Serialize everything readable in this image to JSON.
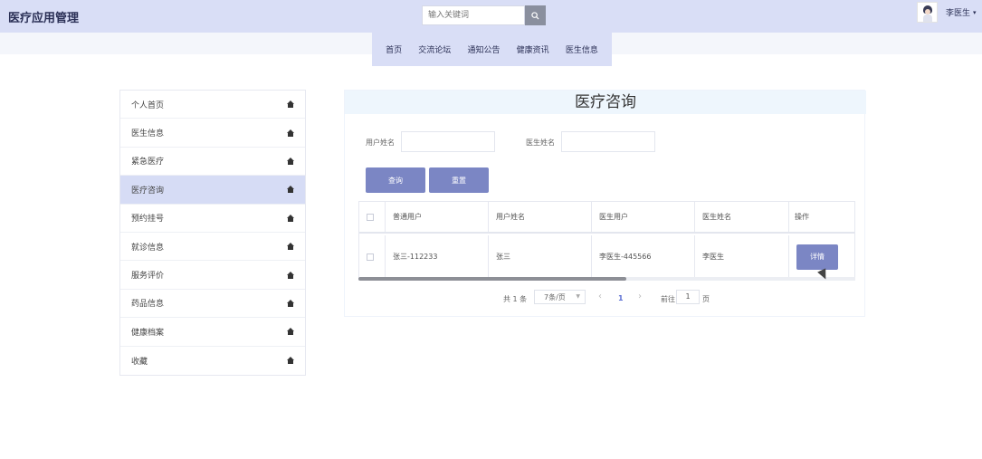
{
  "header": {
    "title": "医疗应用管理",
    "search_placeholder": "输入关键词",
    "search_icon": "search-icon",
    "user_name": "李医生",
    "caret": "▾"
  },
  "nav": {
    "items": [
      "首页",
      "交流论坛",
      "通知公告",
      "健康资讯",
      "医生信息"
    ]
  },
  "sidebar": {
    "items": [
      {
        "label": "个人首页"
      },
      {
        "label": "医生信息"
      },
      {
        "label": "紧急医疗"
      },
      {
        "label": "医疗咨询"
      },
      {
        "label": "预约挂号"
      },
      {
        "label": "就诊信息"
      },
      {
        "label": "服务评价"
      },
      {
        "label": "药品信息"
      },
      {
        "label": "健康档案"
      },
      {
        "label": "收藏"
      }
    ],
    "active_index": 3,
    "item_icon": "home-icon"
  },
  "main": {
    "title": "医疗咨询",
    "filters": {
      "user_name_label": "用户姓名",
      "doctor_name_label": "医生姓名",
      "user_name_value": "",
      "doctor_name_value": ""
    },
    "buttons": {
      "query": "查询",
      "reset": "重置"
    },
    "table": {
      "columns": [
        "普通用户",
        "用户姓名",
        "医生用户",
        "医生姓名",
        "操作"
      ],
      "rows": [
        {
          "user": "张三-112233",
          "user_name": "张三",
          "doctor_user": "李医生-445566",
          "doctor_name": "李医生",
          "action": "详情"
        }
      ]
    },
    "pager": {
      "total": "共 1 条",
      "page_size": "7条/页",
      "prev": "‹",
      "current": "1",
      "next": "›",
      "goto_label": "前往",
      "goto_value": "1",
      "page_suffix": "页"
    }
  },
  "colors": {
    "header_bg": "#d9def6",
    "accent_button": "#7b86c4",
    "active_item": "#d6dcf5",
    "pager_active": "#5b6ed3"
  }
}
